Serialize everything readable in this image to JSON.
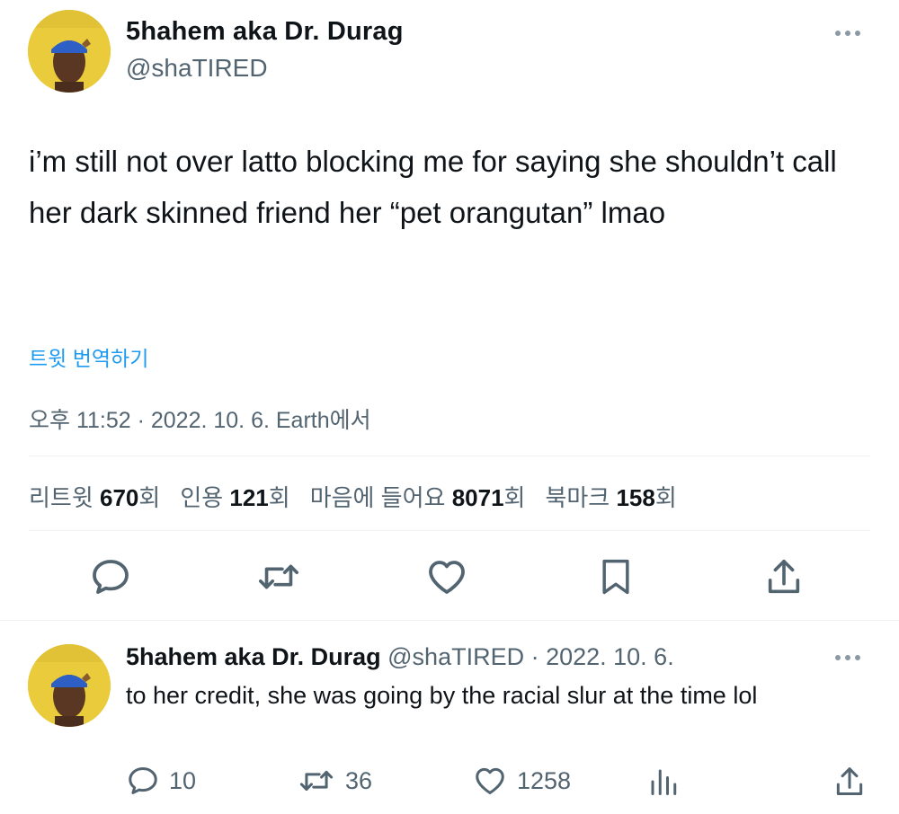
{
  "main_tweet": {
    "display_name": "5hahem aka Dr. Durag",
    "handle": "@shaTIRED",
    "text": "i’m still not over latto blocking me for saying she shouldn’t call her dark skinned friend her “pet orangutan” lmao",
    "translate_label": "트윗 번역하기",
    "timestamp": "오후 11:52 · 2022. 10. 6. Earth에서",
    "stats": {
      "retweets_label": "리트윗",
      "retweets_value": "670",
      "retweets_unit": "회",
      "quotes_label": "인용",
      "quotes_value": "121",
      "quotes_unit": "회",
      "likes_label": "마음에 들어요",
      "likes_value": "8071",
      "likes_unit": "회",
      "bookmarks_label": "북마크",
      "bookmarks_value": "158",
      "bookmarks_unit": "회"
    },
    "actions": [
      "reply-icon",
      "retweet-icon",
      "like-icon",
      "bookmark-icon",
      "share-icon"
    ]
  },
  "reply_tweet": {
    "display_name": "5hahem aka Dr. Durag",
    "handle_date": "@shaTIRED · 2022. 10. 6.",
    "text": "to her credit, she was going by the racial slur at the time lol",
    "reply_count": "10",
    "retweet_count": "36",
    "like_count": "1258",
    "actions": [
      "reply-icon",
      "retweet-icon",
      "like-icon",
      "analytics-icon",
      "share-icon"
    ]
  },
  "colors": {
    "text": "#0f1419",
    "secondary": "#536471",
    "link": "#1d9bf0",
    "divider": "#eff3f4",
    "avatar_bg": "#e8c93a"
  }
}
